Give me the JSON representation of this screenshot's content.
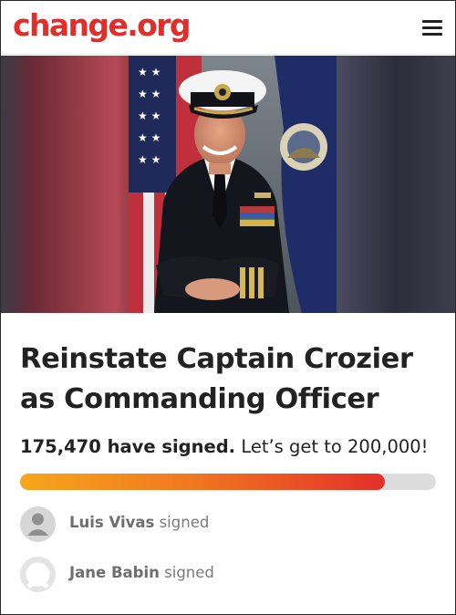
{
  "header": {
    "logo": "change.org",
    "menu_icon": "hamburger-menu-icon"
  },
  "hero": {
    "image": "portrait of navy captain in dress uniform with flags"
  },
  "petition": {
    "title": "Reinstate Captain Crozier as Commanding Officer",
    "signed_count": "175,470 have signed.",
    "goal_text": "Let’s get to 200,000!",
    "signed": 175470,
    "goal": 200000,
    "progress_fraction": 0.877
  },
  "colors": {
    "brand": "#e12e2a",
    "progress_start": "#f6a61c",
    "progress_end": "#e42f2a",
    "progress_track": "#dcdcdc"
  },
  "signers": [
    {
      "name": "Luis Vivas",
      "action": "signed",
      "avatar": "default-avatar-icon"
    },
    {
      "name": "Jane Babin",
      "action": "signed",
      "avatar": "outlined-avatar-icon"
    }
  ]
}
